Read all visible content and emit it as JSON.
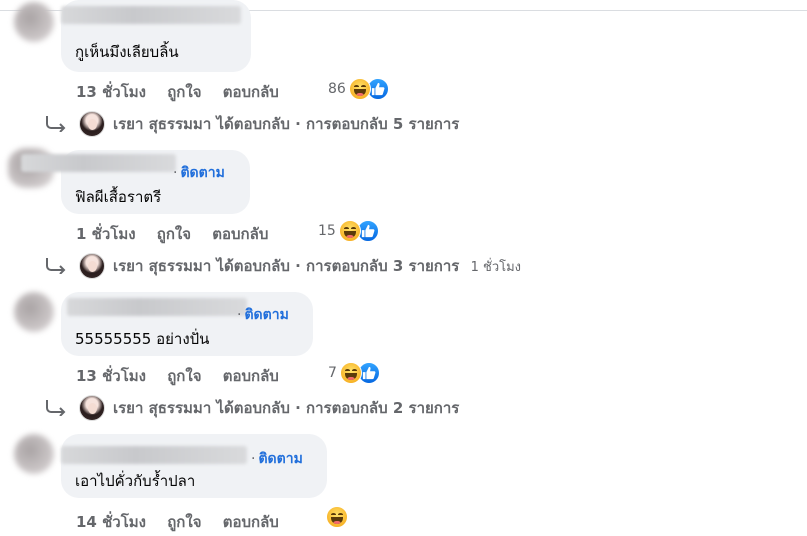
{
  "comments": [
    {
      "text": "กูเห็นมึงเลียบลิ้น",
      "time": "13 ชั่วโมง",
      "like_label": "ถูกใจ",
      "reply_label": "ตอบกลับ",
      "reaction_count": "86",
      "reactions": [
        "haha-icon",
        "like-icon"
      ],
      "reply_summary": {
        "replier": "เรยา สุธรรมมา",
        "action": "ได้ตอบกลับ",
        "separator": "·",
        "count": "การตอบกลับ 5 รายการ",
        "time": ""
      }
    },
    {
      "follow_label": "ติดตาม",
      "text": "ฟิลผีเสื้อราตรี",
      "time": "1 ชั่วโมง",
      "like_label": "ถูกใจ",
      "reply_label": "ตอบกลับ",
      "reaction_count": "15",
      "reactions": [
        "haha-icon",
        "like-icon"
      ],
      "reply_summary": {
        "replier": "เรยา สุธรรมมา",
        "action": "ได้ตอบกลับ",
        "separator": "·",
        "count": "การตอบกลับ 3 รายการ",
        "time": "1 ชั่วโมง"
      }
    },
    {
      "follow_label": "ติดตาม",
      "text": "55555555 อย่างปั่น",
      "time": "13 ชั่วโมง",
      "like_label": "ถูกใจ",
      "reply_label": "ตอบกลับ",
      "reaction_count": "7",
      "reactions": [
        "haha-icon",
        "like-icon"
      ],
      "reply_summary": {
        "replier": "เรยา สุธรรมมา",
        "action": "ได้ตอบกลับ",
        "separator": "·",
        "count": "การตอบกลับ 2 รายการ",
        "time": ""
      }
    },
    {
      "follow_label": "ติดตาม",
      "text": "เอาไปคั่วกับร้ำปลา",
      "time": "14 ชั่วโมง",
      "like_label": "ถูกใจ",
      "reply_label": "ตอบกลับ",
      "reaction_count": "",
      "reactions": [
        "haha-icon"
      ]
    }
  ],
  "colors": {
    "bubble": "#f0f2f5",
    "meta_text": "#65676b",
    "follow_link": "#216fdb",
    "body_text": "#050505"
  }
}
